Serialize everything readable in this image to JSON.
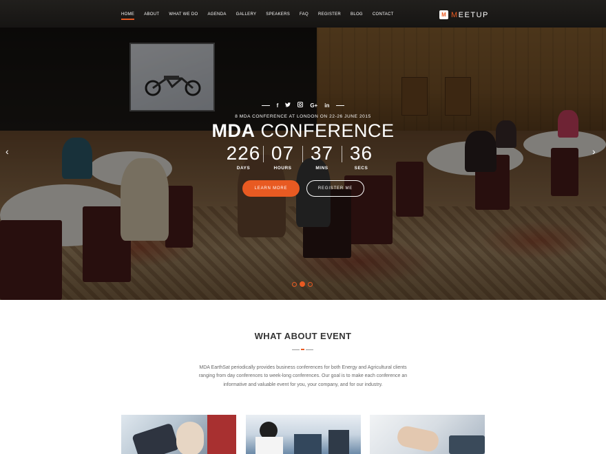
{
  "nav": {
    "items": [
      "HOME",
      "ABOUT",
      "WHAT WE DO",
      "AGENDA",
      "GALLERY",
      "SPEAKERS",
      "FAQ",
      "REGISTER",
      "BLOG",
      "CONTACT"
    ],
    "active": "HOME"
  },
  "logo": {
    "mark": "M",
    "first_letter": "M",
    "rest": "EETUP"
  },
  "social": [
    "facebook-icon",
    "twitter-icon",
    "instagram-icon",
    "google-plus-icon",
    "linkedin-icon"
  ],
  "hero": {
    "tagline": "8 MDA CONFERENCE AT LONDON ON 22-26 JUNE 2015",
    "title_bold": "MDA",
    "title_light": "CONFERENCE",
    "countdown": [
      {
        "value": "226",
        "label": "DAYS"
      },
      {
        "value": "07",
        "label": "HOURS"
      },
      {
        "value": "37",
        "label": "MINS"
      },
      {
        "value": "36",
        "label": "SECS"
      }
    ],
    "learn_more": "LEARN MORE",
    "register": "REGISTER ME",
    "prev_arrow": "‹",
    "next_arrow": "›",
    "slides": 3,
    "active_slide": 2
  },
  "about": {
    "title": "WHAT ABOUT EVENT",
    "lines": [
      "MDA EarthSat periodically provides business conferences for both Energy and Agricultural clients",
      "ranging from day conferences to week-long conferences. Our goal is to make each conference an",
      "informative and valuable event for you, your company, and for our industry."
    ]
  },
  "colors": {
    "accent": "#e85a22",
    "text": "#333333"
  }
}
